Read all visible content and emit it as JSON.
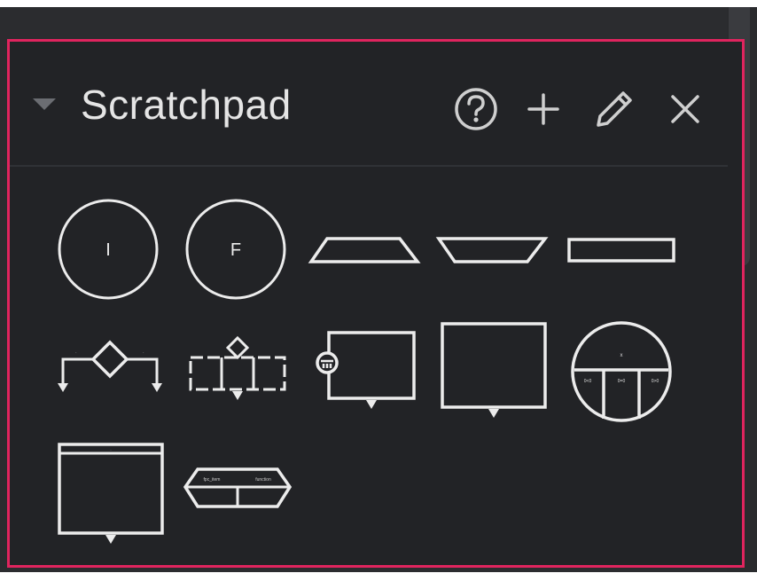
{
  "panel": {
    "title": "Scratchpad",
    "accent_border": "#e0245e",
    "background": "#222326",
    "stroke": "#ececec"
  },
  "header_icons": [
    "collapse-arrow-icon",
    "help-icon",
    "add-icon",
    "edit-icon",
    "close-icon"
  ],
  "shapes": {
    "circle_initial_label": "I",
    "circle_final_label": "F",
    "three_way_circle": {
      "top": "x",
      "left": "0<0",
      "middle": "0=0",
      "right": "0>0"
    },
    "db_split": {
      "left": "fpc_item",
      "right": "function"
    }
  }
}
